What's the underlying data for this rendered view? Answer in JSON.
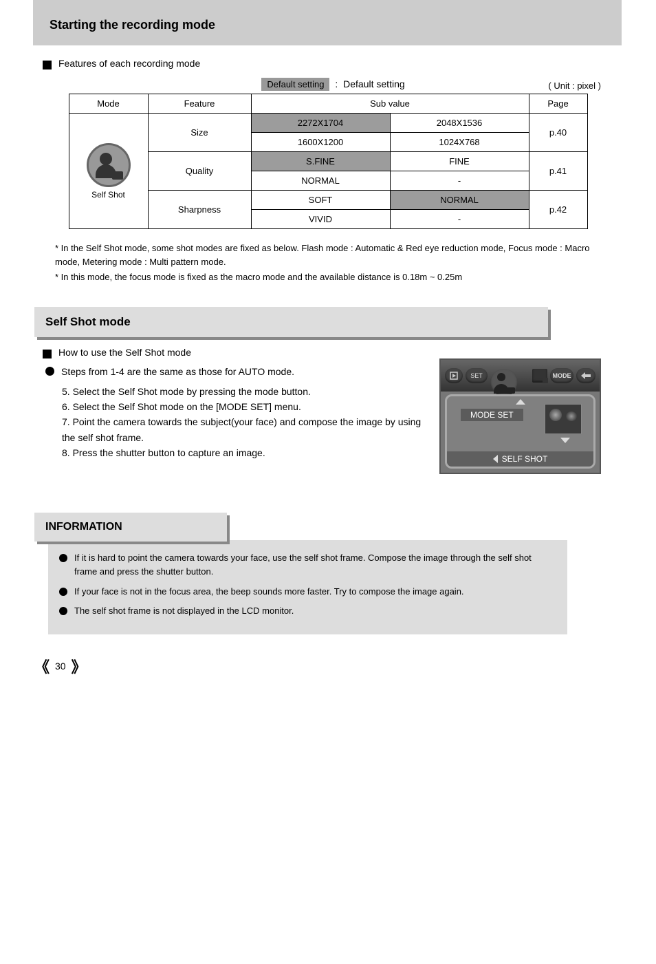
{
  "header": {
    "title": "Starting the recording mode"
  },
  "intro": {
    "text": "Features of each recording mode"
  },
  "table": {
    "default_note": "Default setting",
    "units": "( Unit : pixel )",
    "headers": {
      "mode": "Mode",
      "feature": "Feature",
      "sub_value": "Sub value",
      "page": "Page"
    },
    "mode_label": "Self Shot",
    "rows": [
      {
        "feature": "Size",
        "page": "p.40",
        "r1": {
          "c1": "2272X1704",
          "c2": "2048X1536"
        },
        "r2": {
          "c1": "1600X1200",
          "c2": "1024X768"
        }
      },
      {
        "feature": "Quality",
        "page": "p.41",
        "r1": {
          "c1": "S.FINE",
          "c2": "FINE"
        },
        "r2": {
          "c1": "NORMAL",
          "c2": "-"
        }
      },
      {
        "feature": "Sharpness",
        "page": "p.42",
        "r1": {
          "c1": "SOFT",
          "c2": "NORMAL"
        },
        "r2": {
          "c1": "VIVID",
          "c2": "-"
        }
      }
    ]
  },
  "table_note": "* In the Self Shot mode, some shot modes are fixed as below. Flash mode : Automatic & Red eye reduction mode, Focus mode : Macro mode, Metering mode : Multi pattern mode.",
  "asterisk": "* In this mode, the focus mode is fixed as the macro mode and the available distance is 0.18m ~ 0.25m",
  "section_selfshot": {
    "title": "Self Shot mode",
    "sq_text": "How to use the Self Shot mode",
    "bullet_text": "Steps from 1-4 are the same as those for AUTO mode.",
    "steps": [
      "5. Select the Self Shot mode by pressing the mode button.",
      "6. Select the Self Shot mode on the [MODE SET] menu.",
      "7. Point the camera towards the subject(your face) and compose the image by using the self shot frame.",
      "8. Press the shutter button to capture an image."
    ]
  },
  "lcd": {
    "set": "SET",
    "mode": "MODE",
    "label": "MODE SET",
    "footer": "SELF SHOT"
  },
  "section_info": {
    "title": "INFORMATION",
    "items": [
      "If it is hard to point the camera towards your face, use the self shot frame. Compose the image through the self shot frame and press the shutter button.",
      "If your face is not in the focus area, the beep sounds more faster. Try to compose the image again.",
      "The self shot frame is not displayed in the LCD monitor."
    ]
  },
  "footer": {
    "pagenum": "30"
  }
}
